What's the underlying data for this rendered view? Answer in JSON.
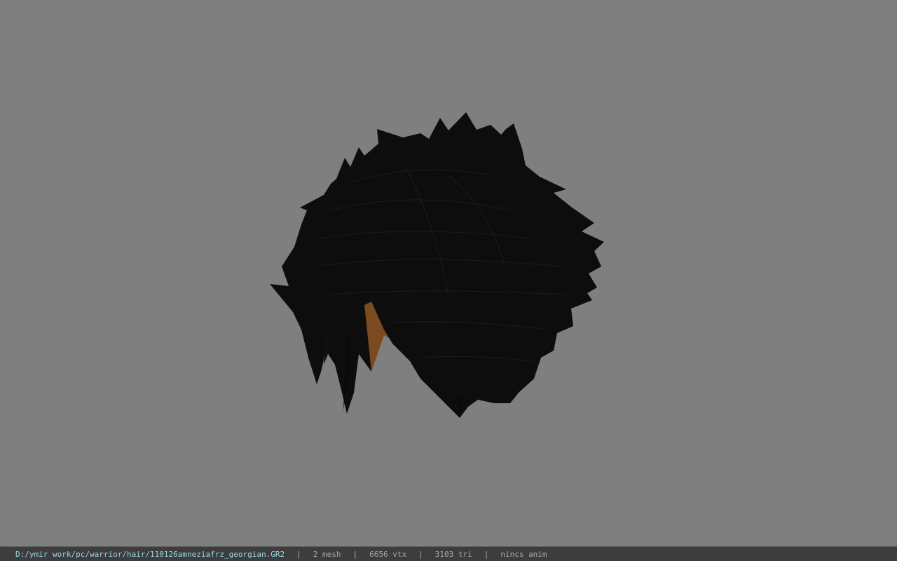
{
  "viewport": {
    "background_color": "#7f7f7f",
    "model_name": "hair-mesh",
    "hair_color": "#0d0d0d",
    "skin_color": "#7a4a20"
  },
  "status_bar": {
    "file_path": "D:/ymir work/pc/warrior/hair/110126amneziafrz_georgian.GR2",
    "separator": "|",
    "mesh_count": "2 mesh",
    "vertex_count": "6656 vtx",
    "triangle_count": "3103 tri",
    "anim_status": "nincs anim",
    "path_color": "#9ad6ea",
    "text_color": "#a8a8a8"
  }
}
